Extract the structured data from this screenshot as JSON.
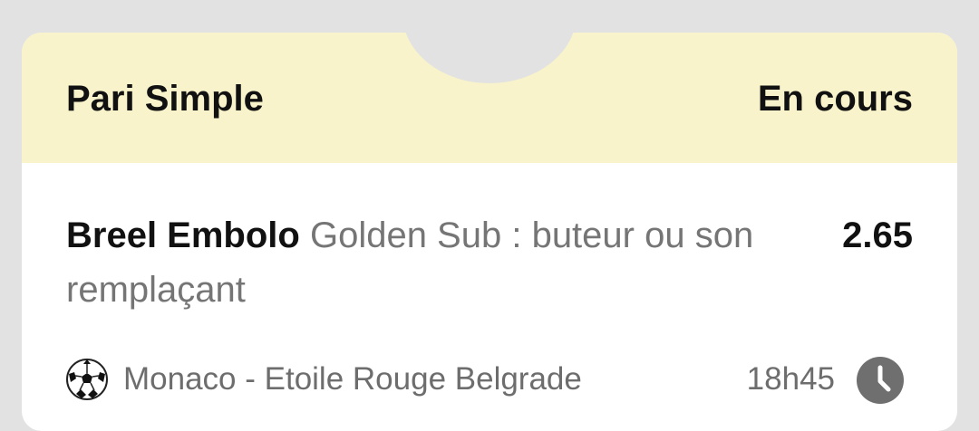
{
  "bet": {
    "type": "Pari Simple",
    "status": "En cours",
    "player": "Breel Embolo",
    "market": " Golden Sub : buteur ou son remplaçant",
    "odds": "2.65"
  },
  "match": {
    "sport_icon": "soccer-ball-icon",
    "name": "Monaco - Etoile Rouge Belgrade",
    "time": "18h45",
    "status_icon": "clock-icon"
  },
  "colors": {
    "background": "#e2e2e2",
    "header": "#f8f3cb",
    "card": "#ffffff",
    "primary_text": "#111111",
    "secondary_text": "#757575",
    "clock": "#6f6f6f"
  }
}
